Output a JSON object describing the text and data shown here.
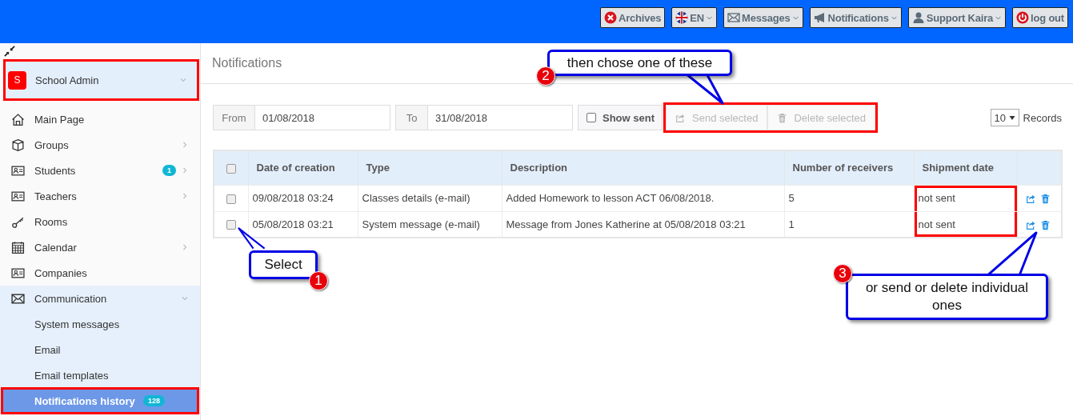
{
  "topbar": {
    "buttons": [
      {
        "label": "Archives",
        "dropdown": false
      },
      {
        "label": "EN",
        "dropdown": true
      },
      {
        "label": "Messages",
        "dropdown": true
      },
      {
        "label": "Notifications",
        "dropdown": true
      },
      {
        "label": "Support Kaira",
        "dropdown": true
      },
      {
        "label": "log out",
        "dropdown": false
      }
    ]
  },
  "sidebar": {
    "profile": {
      "initial": "S",
      "name": "School Admin",
      "expanded": true,
      "highlighted": true
    },
    "items": [
      {
        "label": "Main Page",
        "chevron": false,
        "expanded": false,
        "selected": false
      },
      {
        "label": "Groups",
        "chevron": true,
        "expanded": false,
        "selected": false
      },
      {
        "label": "Students",
        "badge": "1",
        "chevron": true,
        "expanded": false,
        "selected": false
      },
      {
        "label": "Teachers",
        "chevron": true,
        "expanded": false,
        "selected": false
      },
      {
        "label": "Rooms",
        "chevron": false,
        "expanded": false,
        "selected": false
      },
      {
        "label": "Calendar",
        "chevron": true,
        "expanded": false,
        "selected": false
      },
      {
        "label": "Companies",
        "chevron": false,
        "expanded": false,
        "selected": false
      },
      {
        "label": "Communication",
        "chevron": true,
        "expanded": true,
        "selected": false,
        "children": [
          {
            "label": "System messages",
            "selected": false,
            "highlighted": false
          },
          {
            "label": "Email",
            "selected": false,
            "highlighted": false
          },
          {
            "label": "Email templates",
            "selected": false,
            "highlighted": false
          },
          {
            "label": "Notifications history",
            "badge": "128",
            "selected": true,
            "highlighted": true
          }
        ]
      }
    ]
  },
  "page": {
    "title": "Notifications"
  },
  "filters": {
    "from": {
      "label": "From",
      "value": "01/08/2018"
    },
    "to": {
      "label": "To",
      "value": "31/08/2018"
    },
    "show_sent": {
      "label": "Show sent",
      "checked": false
    },
    "bulk_actions": {
      "highlighted": true,
      "buttons": [
        {
          "label": "Send selected",
          "disabled": true
        },
        {
          "label": "Delete selected",
          "disabled": true
        }
      ]
    },
    "records": {
      "value": "10",
      "label": "Records"
    }
  },
  "table": {
    "all_checked": false,
    "columns": [
      {
        "label": "Date of creation",
        "highlighted": false
      },
      {
        "label": "Type",
        "highlighted": false
      },
      {
        "label": "Description",
        "highlighted": false
      },
      {
        "label": "Number of receivers",
        "highlighted": false
      },
      {
        "label": "Shipment date",
        "highlighted": true
      }
    ],
    "rows": [
      {
        "selected": false,
        "cells": [
          "09/08/2018 03:24",
          "Classes details (e-mail)",
          "Added Homework to lesson ACT 06/08/2018.",
          "5",
          "not sent"
        ]
      },
      {
        "selected": false,
        "cells": [
          "05/08/2018 03:21",
          "System message (e-mail)",
          "Message from Jones Katherine at 05/08/2018 03:21",
          "1",
          "not sent"
        ]
      }
    ]
  },
  "callouts": [
    {
      "number": "1",
      "text": "Select"
    },
    {
      "number": "2",
      "text": "then chose one of these"
    },
    {
      "number": "3",
      "text": "or send or delete individual ones"
    }
  ]
}
